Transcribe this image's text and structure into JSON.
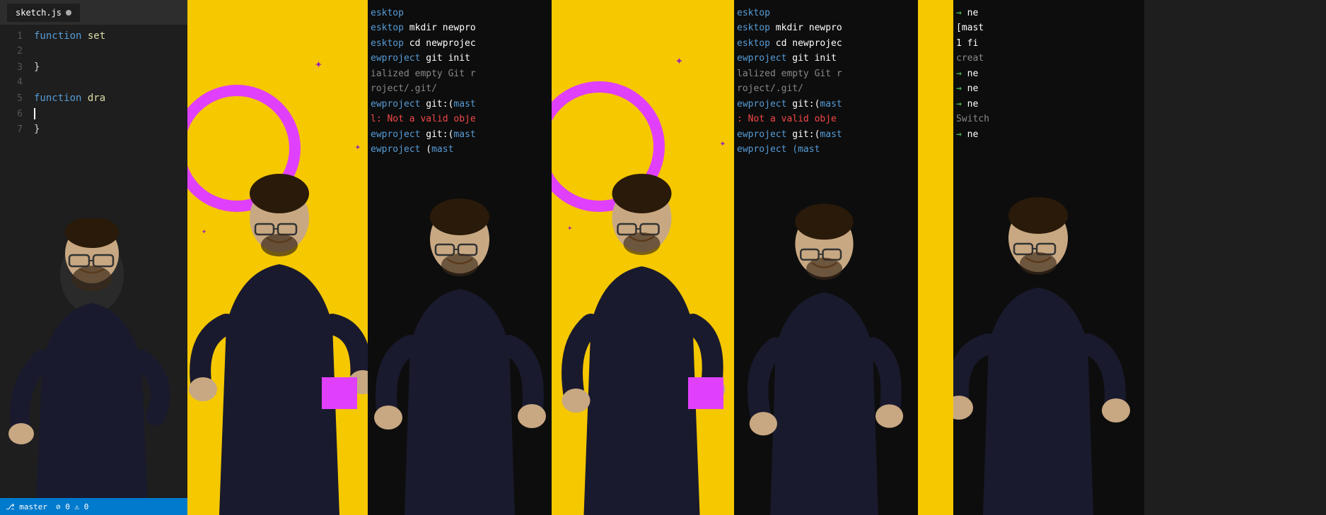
{
  "panels": {
    "code_editor": {
      "tab_name": "sketch.js",
      "tab_has_dot": true,
      "lines": [
        {
          "num": "1",
          "content": "function set",
          "type": "code"
        },
        {
          "num": "2",
          "content": "",
          "type": "empty"
        },
        {
          "num": "3",
          "content": "}",
          "type": "code"
        },
        {
          "num": "4",
          "content": "",
          "type": "empty"
        },
        {
          "num": "5",
          "content": "function dra",
          "type": "code"
        },
        {
          "num": "6",
          "content": "",
          "type": "cursor"
        },
        {
          "num": "7",
          "content": "}",
          "type": "code"
        }
      ],
      "status": {
        "branch": "master",
        "errors": "0",
        "warnings": "0"
      }
    },
    "terminal_1": {
      "lines": [
        "esktop",
        "esktop mkdir newpro",
        "esktop cd newprojec",
        "ewproject git init",
        "ialized empty Git r",
        "roject/.git/",
        "ewproject git:(mast",
        "l: Not a valid obje",
        "ewproject git:(mast",
        "ewproject  (mast"
      ]
    },
    "terminal_2": {
      "lines": [
        "esktop",
        "esktop mkdir newpro",
        "esktop cd newprojec",
        "ewproject git init",
        "ialized empty Git r",
        "roject/.git/",
        "ewproject git:(mast",
        ": Not a valid obje",
        "ewproject git:(mast",
        "ewproject  (mast"
      ]
    },
    "terminal_last": {
      "lines": [
        "→ ne",
        "[mast",
        "  1 fi",
        "  creat",
        "→ ne",
        "→ ne",
        "→ ne",
        "Switch",
        "→ ne"
      ]
    }
  },
  "colors": {
    "yellow_bg": "#f5c800",
    "terminal_bg": "#0d0d0d",
    "code_bg": "#1e1e1e",
    "tab_bg": "#2d2d2d",
    "keyword_blue": "#569cd6",
    "keyword_yellow": "#dcdcaa",
    "green_arrow": "#4caf50",
    "cyan": "#4ec9b0",
    "purple": "#e040fb",
    "white": "#ffffff",
    "gray_text": "#888888"
  }
}
